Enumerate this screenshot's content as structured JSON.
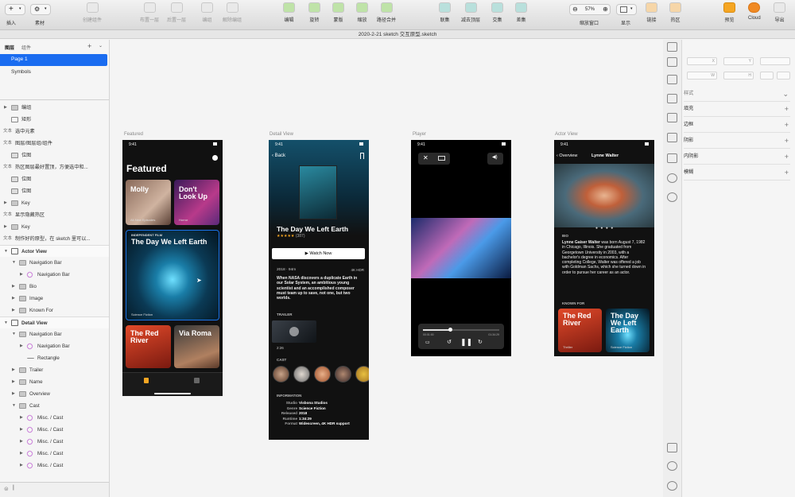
{
  "toolbar": {
    "insert": "插入",
    "assets": "素材",
    "create_symbol": "创建组件",
    "group": "布置一层",
    "group2": "后置一层",
    "edit": "编组",
    "ungroup": "解除编组",
    "edit2": "编辑",
    "rotate": "旋转",
    "mask": "蒙版",
    "scale": "缩放",
    "merge": "路径合并",
    "union": "联集",
    "subtract": "减去顶层",
    "intersect": "交集",
    "difference": "差集",
    "zoom_value": "57%",
    "zoom_label": "缩放窗口",
    "display": "显示",
    "link": "链接",
    "hotspot": "热区",
    "preview": "预览",
    "cloud": "Cloud",
    "export": "导出"
  },
  "document_title": "2020-2-21 sketch 交互原型.sketch",
  "left_panel": {
    "tabs": [
      "图层",
      "组件"
    ],
    "pages": [
      "Page 1",
      "Symbols"
    ],
    "layers": [
      {
        "label": "编组",
        "kind": "fold",
        "indent": 0,
        "tri": "▶"
      },
      {
        "label": "矩形",
        "kind": "box",
        "indent": 0,
        "tri": ""
      },
      {
        "label": "选中元素",
        "kind": "txt",
        "indent": 0,
        "tri": ""
      },
      {
        "label": "图层/图层组/组件",
        "kind": "txt",
        "indent": 0,
        "tri": ""
      },
      {
        "label": "位图",
        "kind": "img",
        "indent": 0,
        "tri": ""
      },
      {
        "label": "热区图层最好置顶，方便选中和...",
        "kind": "txt",
        "indent": 0,
        "tri": ""
      },
      {
        "label": "位图",
        "kind": "img",
        "indent": 0,
        "tri": ""
      },
      {
        "label": "位图",
        "kind": "img",
        "indent": 0,
        "tri": ""
      },
      {
        "label": "Key",
        "kind": "fold",
        "indent": 0,
        "tri": "▶"
      },
      {
        "label": "显示隐藏热区",
        "kind": "txt",
        "indent": 0,
        "tri": ""
      },
      {
        "label": "Key",
        "kind": "fold",
        "indent": 0,
        "tri": "▶"
      },
      {
        "label": "制作好的原型，在 sketch 里可以...",
        "kind": "txt",
        "indent": 0,
        "tri": ""
      },
      {
        "label": "Actor View",
        "kind": "art",
        "indent": 0,
        "tri": "▼"
      },
      {
        "label": "Navigation Bar",
        "kind": "fold",
        "indent": 1,
        "tri": "▼"
      },
      {
        "label": "Navigation Bar",
        "kind": "sym",
        "indent": 2,
        "tri": "▶"
      },
      {
        "label": "Bio",
        "kind": "fold",
        "indent": 1,
        "tri": "▶"
      },
      {
        "label": "Image",
        "kind": "fold",
        "indent": 1,
        "tri": "▶"
      },
      {
        "label": "Known For",
        "kind": "fold",
        "indent": 1,
        "tri": "▶"
      },
      {
        "label": "Detail View",
        "kind": "art",
        "indent": 0,
        "tri": "▼"
      },
      {
        "label": "Navigation Bar",
        "kind": "fold",
        "indent": 1,
        "tri": "▼"
      },
      {
        "label": "Navigation Bar",
        "kind": "sym",
        "indent": 2,
        "tri": "▶"
      },
      {
        "label": "Rectangle",
        "kind": "line",
        "indent": 2,
        "tri": ""
      },
      {
        "label": "Trailer",
        "kind": "fold",
        "indent": 1,
        "tri": "▶"
      },
      {
        "label": "Name",
        "kind": "fold",
        "indent": 1,
        "tri": "▶"
      },
      {
        "label": "Overview",
        "kind": "fold",
        "indent": 1,
        "tri": "▶"
      },
      {
        "label": "Cast",
        "kind": "fold",
        "indent": 1,
        "tri": "▼"
      },
      {
        "label": "Misc. / Cast",
        "kind": "sym",
        "indent": 2,
        "tri": "▶"
      },
      {
        "label": "Misc. / Cast",
        "kind": "sym",
        "indent": 2,
        "tri": "▶"
      },
      {
        "label": "Misc. / Cast",
        "kind": "sym",
        "indent": 2,
        "tri": "▶"
      },
      {
        "label": "Misc. / Cast",
        "kind": "sym",
        "indent": 2,
        "tri": "▶"
      },
      {
        "label": "Misc. / Cast",
        "kind": "sym",
        "indent": 2,
        "tri": "▶"
      }
    ],
    "txt_prefix": "文本"
  },
  "inspector": {
    "fields": [
      "X",
      "Y",
      "W",
      "H"
    ],
    "style": "样式",
    "sections": [
      "填充",
      "边框",
      "阴影",
      "内阴影",
      "模糊"
    ]
  },
  "artboards": {
    "featured": {
      "label": "Featured",
      "time": "9:41",
      "title": "Featured",
      "cards": [
        {
          "title": "Molly",
          "sub": "All-New Episodes"
        },
        {
          "title": "Don't Look Up",
          "sub": "Horror"
        },
        {
          "kicker": "INDEPENDENT FILM",
          "title": "The Day We Left Earth",
          "sub": "Science Fiction"
        },
        {
          "title": "The Red River",
          "sub": ""
        },
        {
          "title": "Via Roma",
          "sub": ""
        }
      ]
    },
    "detail": {
      "label": "Detail View",
      "time": "9:41",
      "back": "Back",
      "movie": "The Day We Left Earth",
      "rating_count": "(387)",
      "stars": "★★★★★",
      "watch": "Watch Now",
      "meta": "2018 · 94m",
      "badges": "4K HDR",
      "synopsis": "When NASA discovers a duplicate Earth in our Solar System, an ambitious young scientist and an accomplished composer must team up to save, not one, but two worlds.",
      "trailer": "TRAILER",
      "trailer_time": "2:26",
      "cast": "CAST",
      "info": "INFORMATION",
      "info_rows": [
        [
          "Studio",
          "Visbona Studios"
        ],
        [
          "Genre",
          "Science Fiction"
        ],
        [
          "Released",
          "2018"
        ],
        [
          "Runtime",
          "1:34:29"
        ],
        [
          "Format",
          "Widescreen, 4K HDR support"
        ]
      ]
    },
    "player": {
      "label": "Player",
      "time": "9:41",
      "t_start": "00:01:00",
      "t_end": "01:34:29"
    },
    "actor": {
      "label": "Actor View",
      "time": "9:41",
      "back": "Overview",
      "name": "Lynne Walter",
      "bio_h": "BIO",
      "bio_name": "Lynne Gaiser Walter",
      "bio": " was born August 7, 1982 in Chicago, Illinois. She graduated from Georgetown University in 2003, with a bachelor's degree in economics. After completing College, Walter was offered a job with Goldman Sachs, which she turned down in order to pursue her career as an actor.",
      "known": "KNOWN FOR",
      "cards": [
        {
          "title": "The Red River",
          "sub": "Thriller"
        },
        {
          "title": "The Day We Left Earth",
          "sub": "Science Fiction"
        }
      ]
    }
  },
  "colors": {
    "accent": "#1a73e8",
    "page_selected": "#1a6cf0"
  }
}
